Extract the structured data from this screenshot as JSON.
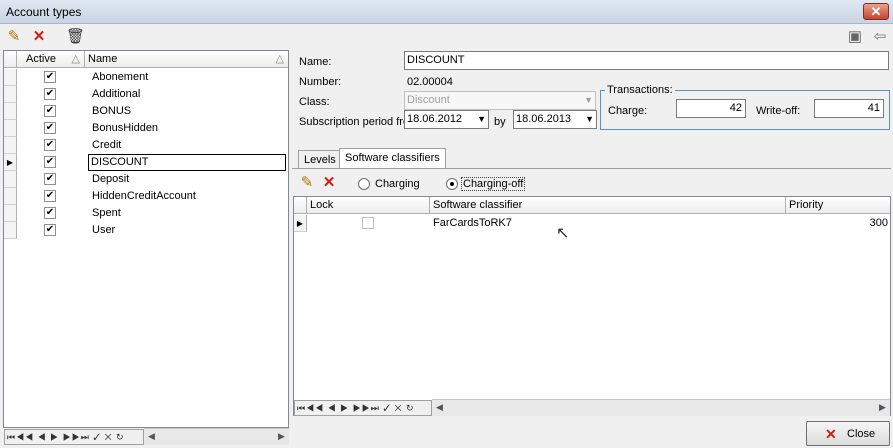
{
  "window": {
    "title": "Account types",
    "close_glyph": "✕"
  },
  "toolbar": {
    "new_icon": "new-document-icon",
    "delete_icon": "red-x-icon",
    "trash_icon": "trash-icon",
    "save_icon": "floppy-disk-icon",
    "back_icon": "back-arrow-icon"
  },
  "left_grid": {
    "columns": {
      "active": "Active",
      "name": "Name"
    },
    "rows": [
      {
        "name": "Abonement",
        "active": true
      },
      {
        "name": "Additional",
        "active": true
      },
      {
        "name": "BONUS",
        "active": true
      },
      {
        "name": "BonusHidden",
        "active": true
      },
      {
        "name": "Credit",
        "active": true
      },
      {
        "name": "DISCOUNT",
        "active": true,
        "selected": true
      },
      {
        "name": "Deposit",
        "active": true
      },
      {
        "name": "HiddenCreditAccount",
        "active": true
      },
      {
        "name": "Spent",
        "active": true
      },
      {
        "name": "User",
        "active": true
      }
    ]
  },
  "form": {
    "name_label": "Name:",
    "name_value": "DISCOUNT",
    "number_label": "Number:",
    "number_value": "02.00004",
    "class_label": "Class:",
    "class_value": "Discount",
    "period_label": "Subscription period fro",
    "period_from": "18.06.2012",
    "by_label": "by",
    "period_to": "18.06.2013"
  },
  "transactions": {
    "legend": "Transactions:",
    "charge_label": "Charge:",
    "charge_value": "42",
    "writeoff_label": "Write-off:",
    "writeoff_value": "41"
  },
  "tabs": {
    "levels": "Levels",
    "software": "Software classifiers"
  },
  "software_panel": {
    "radio_charging": "Charging",
    "radio_chargingoff": "Charging-off",
    "columns": {
      "lock": "Lock",
      "classifier": "Software classifier",
      "priority": "Priority"
    },
    "rows": [
      {
        "lock": false,
        "classifier": "FarCardsToRK7",
        "priority": "300"
      }
    ]
  },
  "footer": {
    "close_label": "Close"
  },
  "colors": {
    "title_gradient_top": "#dfe7f1",
    "close_red": "#c6442c",
    "transactions_border": "#5b8fc7"
  }
}
